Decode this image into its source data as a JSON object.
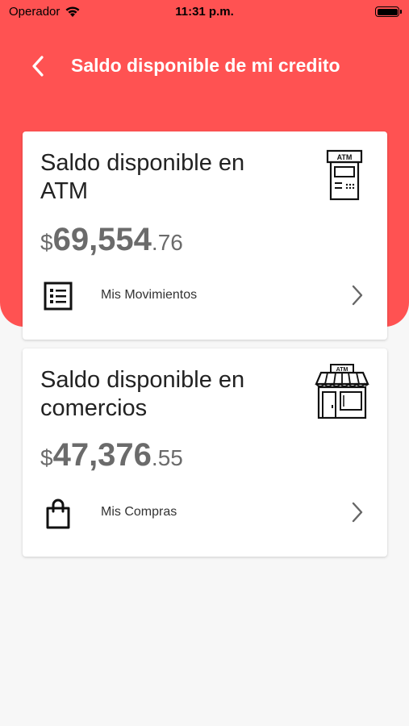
{
  "status_bar": {
    "carrier": "Operador",
    "time": "11:31 p.m."
  },
  "nav": {
    "title": "Saldo disponible de mi credito"
  },
  "cards": [
    {
      "title": "Saldo disponible en ATM",
      "currency": "$",
      "amount_int": "69,554",
      "amount_dec": ".76",
      "icon": "atm-icon",
      "icon_label": "ATM",
      "action_label": "Mis Movimientos",
      "action_icon": "list-icon"
    },
    {
      "title": "Saldo disponible en comercios",
      "currency": "$",
      "amount_int": "47,376",
      "amount_dec": ".55",
      "icon": "store-icon",
      "icon_label": "ATM",
      "action_label": "Mis Compras",
      "action_icon": "shopping-bag-icon"
    }
  ],
  "colors": {
    "accent": "#ff5252",
    "background": "#f7f7f7",
    "card": "#ffffff",
    "amount": "#6b6b6b"
  }
}
